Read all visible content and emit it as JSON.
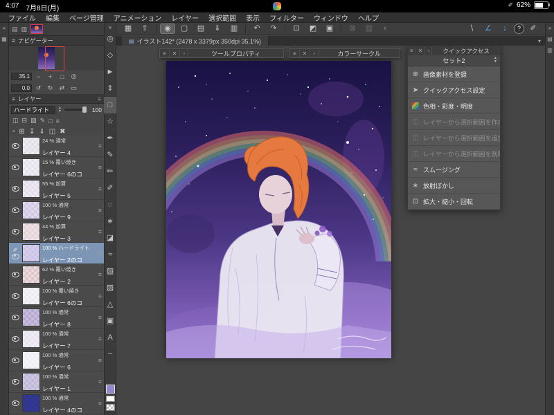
{
  "status_bar": {
    "time": "4:07",
    "date": "7月8日(月)",
    "battery_percent": "62%"
  },
  "menu_bar": {
    "items": [
      "ファイル",
      "編集",
      "ページ管理",
      "アニメーション",
      "レイヤー",
      "選択範囲",
      "表示",
      "フィルター",
      "ウィンドウ",
      "ヘルプ"
    ]
  },
  "icons": {
    "collapse_left": "«",
    "collapse_right": "»",
    "grid": "▦",
    "panel_a": "▤",
    "panel_b": "▥",
    "grip": "≡",
    "menu": "≡",
    "close": "✕",
    "minimize": "▫",
    "dropdown": "▾",
    "spinner": "▲▼",
    "pen": "✐"
  },
  "toolbar": {
    "icons": [
      {
        "name": "workspace-grid-icon",
        "glyph": "▦"
      },
      {
        "name": "share-icon",
        "glyph": "⇧"
      },
      {
        "name": "brush-size-icon",
        "glyph": "◉"
      },
      {
        "name": "new-canvas-icon",
        "glyph": "▢"
      },
      {
        "name": "open-icon",
        "glyph": "▤"
      },
      {
        "name": "save-icon",
        "glyph": "⇓"
      },
      {
        "name": "export-icon",
        "glyph": "▥"
      },
      {
        "name": "undo-icon",
        "glyph": "↶"
      },
      {
        "name": "redo-icon",
        "glyph": "↷"
      },
      {
        "name": "deselect-icon",
        "glyph": "⊡"
      },
      {
        "name": "invert-selection-icon",
        "glyph": "◩"
      },
      {
        "name": "selection-border-icon",
        "glyph": "▣"
      },
      {
        "name": "scale-rotate-icon",
        "glyph": "⊠"
      },
      {
        "name": "mesh-transform-icon",
        "glyph": "▨"
      },
      {
        "name": "liquify-icon",
        "glyph": "◐"
      },
      {
        "name": "snap-ruler-icon",
        "glyph": "∖"
      },
      {
        "name": "snap-special-ruler-icon",
        "glyph": "∠"
      },
      {
        "name": "snap-grid-icon",
        "glyph": "↓"
      },
      {
        "name": "help-button",
        "glyph": "?"
      },
      {
        "name": "stylus-icon",
        "glyph": "✐"
      }
    ]
  },
  "doc_tab": {
    "title": "イラスト142* (2478 x 3379px 350dpi 35.1%)"
  },
  "tool_strip": {
    "tools": [
      {
        "name": "zoom-tool",
        "glyph": "◎"
      },
      {
        "name": "move-tool",
        "glyph": "◇"
      },
      {
        "name": "operation-tool",
        "glyph": "►"
      },
      {
        "name": "layer-move-tool",
        "glyph": "⇕"
      },
      {
        "name": "selection-tool",
        "glyph": "□"
      },
      {
        "name": "auto-select-tool",
        "glyph": "☆"
      },
      {
        "name": "eyedropper-tool",
        "glyph": "✒"
      },
      {
        "name": "pen-tool",
        "glyph": "✎"
      },
      {
        "name": "pencil-tool",
        "glyph": "✏"
      },
      {
        "name": "brush-tool",
        "glyph": "✐"
      },
      {
        "name": "airbrush-tool",
        "glyph": "◌"
      },
      {
        "name": "decoration-tool",
        "glyph": "∗"
      },
      {
        "name": "eraser-tool",
        "glyph": "◪"
      },
      {
        "name": "blend-tool",
        "glyph": "≈"
      },
      {
        "name": "fill-tool",
        "glyph": "▨"
      },
      {
        "name": "gradient-tool",
        "glyph": "▧"
      },
      {
        "name": "figure-tool",
        "glyph": "△"
      },
      {
        "name": "frame-tool",
        "glyph": "▣"
      },
      {
        "name": "text-tool",
        "glyph": "A"
      },
      {
        "name": "line-correct-tool",
        "glyph": "~"
      }
    ],
    "fg_color": "#9488cc"
  },
  "navigator": {
    "title": "ナビゲーター",
    "zoom_value": "35.1",
    "rotation_value": "0.0",
    "controls_zoom": [
      {
        "name": "zoom-out-button",
        "glyph": "−"
      },
      {
        "name": "zoom-in-button",
        "glyph": "+"
      },
      {
        "name": "fit-to-screen-button",
        "glyph": "□"
      },
      {
        "name": "actual-size-button",
        "glyph": "◎"
      }
    ],
    "controls_rotate": [
      {
        "name": "rotate-ccw-button",
        "glyph": "↺"
      },
      {
        "name": "rotate-cw-button",
        "glyph": "↻"
      },
      {
        "name": "flip-horizontal-button",
        "glyph": "⇄"
      },
      {
        "name": "reset-view-button",
        "glyph": "▭"
      }
    ]
  },
  "layer_panel": {
    "title": "レイヤー",
    "blend_mode": "ハードライト",
    "opacity": "100",
    "lock_icons": [
      {
        "name": "clip-to-layer-icon",
        "glyph": "◫"
      },
      {
        "name": "lock-layer-icon",
        "glyph": "⊟"
      },
      {
        "name": "lock-transparent-icon",
        "glyph": "▨"
      },
      {
        "name": "draft-layer-icon",
        "glyph": "✎"
      },
      {
        "name": "layer-mask-icon",
        "glyph": "□"
      },
      {
        "name": "palette-options-icon",
        "glyph": "≡"
      }
    ],
    "command_icons": [
      {
        "name": "new-layer-icon",
        "glyph": "▫"
      },
      {
        "name": "new-folder-icon",
        "glyph": "⊞"
      },
      {
        "name": "transfer-down-icon",
        "glyph": "↧"
      },
      {
        "name": "merge-down-icon",
        "glyph": "⇓"
      },
      {
        "name": "mask-icon",
        "glyph": "◫"
      },
      {
        "name": "delete-layer-icon",
        "glyph": "✖"
      }
    ],
    "layers": [
      {
        "opacity": "24 %",
        "mode": "通常",
        "name": "レイヤー 4",
        "thumb": "rgba(235,232,242,0.75)"
      },
      {
        "opacity": "15 %",
        "mode": "覆い焼き",
        "name": "レイヤー 6のコ",
        "thumb": "rgba(240,238,246,0.7)"
      },
      {
        "opacity": "55 %",
        "mode": "加算",
        "name": "レイヤー 5",
        "thumb": "rgba(236,230,244,0.7)"
      },
      {
        "opacity": "100 %",
        "mode": "通常",
        "name": "レイヤー 9",
        "thumb": "rgba(214,200,238,0.65)"
      },
      {
        "opacity": "44 %",
        "mode": "加算",
        "name": "レイヤー 3",
        "thumb": "rgba(238,216,224,0.7)"
      },
      {
        "opacity": "100 %",
        "mode": "ハードライト",
        "name": "レイヤー 2のコ",
        "thumb": "rgba(205,195,235,0.8)"
      },
      {
        "opacity": "62 %",
        "mode": "覆い焼き",
        "name": "レイヤー 2",
        "thumb": "rgba(232,200,205,0.6)"
      },
      {
        "opacity": "100 %",
        "mode": "覆い焼き",
        "name": "レイヤー 6のコ",
        "thumb": "rgba(244,242,248,0.8)"
      },
      {
        "opacity": "100 %",
        "mode": "通常",
        "name": "レイヤー 8",
        "thumb": "rgba(170,150,210,0.6)"
      },
      {
        "opacity": "100 %",
        "mode": "通常",
        "name": "レイヤー 7",
        "thumb": "rgba(238,234,246,0.8)"
      },
      {
        "opacity": "100 %",
        "mode": "通常",
        "name": "レイヤー 6",
        "thumb": "rgba(246,244,250,0.85)"
      },
      {
        "opacity": "100 %",
        "mode": "通常",
        "name": "レイヤー 1",
        "thumb": "rgba(190,180,220,0.7)"
      },
      {
        "opacity": "100 %",
        "mode": "通常",
        "name": "レイヤー 4のコ",
        "thumb": "rgba(40,45,140,0.95)"
      }
    ]
  },
  "floating": {
    "tool_property": {
      "title": "ツールプロパティ"
    },
    "color_circle": {
      "title": "カラーサークル"
    }
  },
  "quick_access": {
    "title": "クイックアクセス",
    "set_label": "セット2",
    "items": [
      {
        "label": "画像素材を登録",
        "icon": "⊕",
        "disabled": false
      },
      {
        "label": "クイックアクセス設定",
        "icon": "➤",
        "disabled": false
      },
      {
        "label": "色相・彩度・明度",
        "icon": "▦",
        "disabled": false
      },
      {
        "label": "レイヤーから選択範囲を作成",
        "icon": "◫",
        "disabled": true
      },
      {
        "label": "レイヤーから選択範囲を追加",
        "icon": "◫",
        "disabled": true
      },
      {
        "label": "レイヤーから選択範囲を削除",
        "icon": "◫",
        "disabled": true
      },
      {
        "label": "スムージング",
        "icon": "≈",
        "disabled": false
      },
      {
        "label": "放射ぼかし",
        "icon": "∗",
        "disabled": false
      },
      {
        "label": "拡大・縮小・回転",
        "icon": "⊡",
        "disabled": false
      }
    ]
  }
}
